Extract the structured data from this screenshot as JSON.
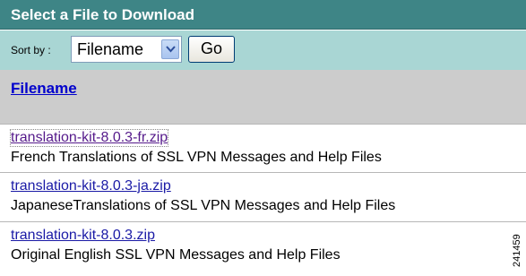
{
  "title": "Select a File to Download",
  "sort": {
    "label": "Sort by :",
    "selected": "Filename",
    "go_label": "Go"
  },
  "table": {
    "header": "Filename",
    "rows": [
      {
        "filename": "translation-kit-8.0.3-fr.zip",
        "description": "French Translations of SSL VPN Messages and Help Files"
      },
      {
        "filename": "translation-kit-8.0.3-ja.zip",
        "description": "JapaneseTranslations of SSL VPN Messages and Help Files"
      },
      {
        "filename": "translation-kit-8.0.3.zip",
        "description": "Original English SSL VPN Messages and Help Files"
      }
    ]
  },
  "figure_id": "241459",
  "colors": {
    "title_bg": "#3e8586",
    "sort_bg": "#a9d6d4",
    "header_bg": "#cccccc",
    "link": "#1a1aa6"
  },
  "icons": {
    "dropdown": "chevron-down-icon"
  }
}
